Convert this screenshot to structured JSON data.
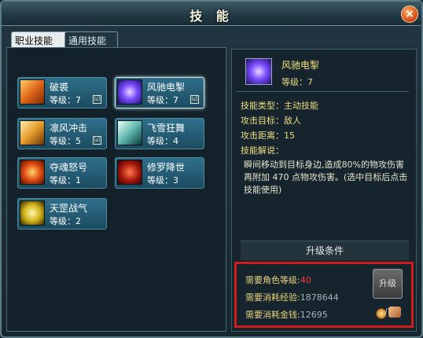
{
  "window": {
    "title": "技 能",
    "close": "×"
  },
  "tabs": [
    {
      "label": "职业技能"
    },
    {
      "label": "通用技能"
    }
  ],
  "skills": [
    {
      "name": "破裘",
      "level": "等级：7",
      "checked": true
    },
    {
      "name": "风驰电掣",
      "level": "等级：7",
      "checked": true
    },
    {
      "name": "凛风冲击",
      "level": "等级：5",
      "checked": true
    },
    {
      "name": "飞雪狂舞",
      "level": "等级：4"
    },
    {
      "name": "夺魂怒号",
      "level": "等级：1"
    },
    {
      "name": "修罗降世",
      "level": "等级：3"
    },
    {
      "name": "天罡战气",
      "level": "等级：2"
    }
  ],
  "check_mark": "☑",
  "detail": {
    "name": "风驰电掣",
    "level": "等级：7",
    "type_label": "技能类型：",
    "type_value": "主动技能",
    "target_label": "攻击目标：",
    "target_value": "敌人",
    "range_label": "攻击距离：",
    "range_value": "15",
    "desc_label": "技能解说：",
    "description": "瞬间移动到目标身边,造成80%的物攻伤害再附加 470 点物攻伤害。(选中目标后点击技能使用)"
  },
  "upgrade": {
    "header": "升级条件",
    "req_level_label": "需要角色等级:",
    "req_level_value": "40",
    "req_exp_label": "需要消耗经验:",
    "req_exp_value": "1878644",
    "req_gold_label": "需要消耗金钱:",
    "req_gold_value": "12695",
    "button": "升级",
    "slash": "/"
  },
  "colors": {
    "highlight_border": "#d41b1b",
    "gold_text": "#f1de80",
    "red_value": "#ff3b3b"
  }
}
